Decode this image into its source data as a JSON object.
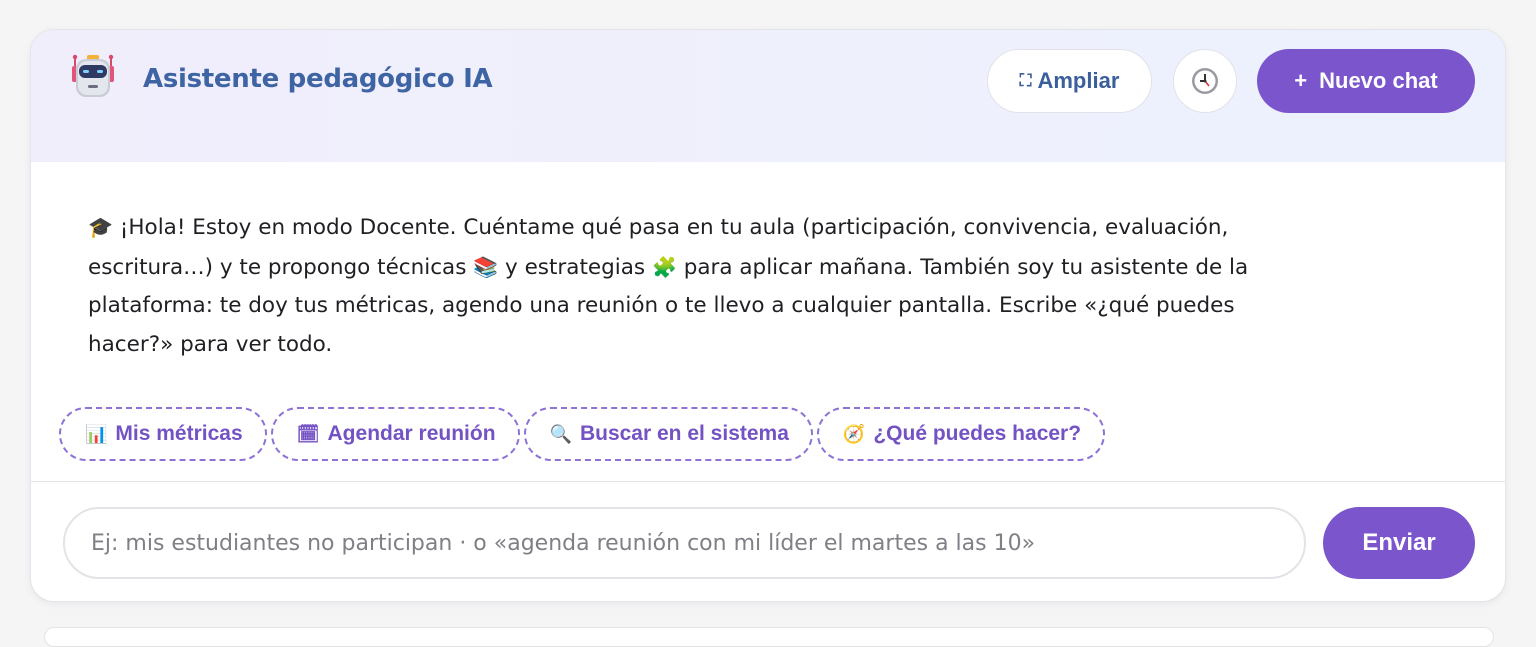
{
  "header": {
    "robot_icon": "robot-icon",
    "title": "Asistente pedagógico IA",
    "expand_icon": "expand-icon",
    "expand_label": "Ampliar",
    "history_icon": "clock-icon",
    "new_chat_plus": "+",
    "new_chat_label": "Nuevo chat"
  },
  "message": {
    "icon": "graduation-cap-icon",
    "part1": "¡Hola! Estoy en modo Docente. Cuéntame qué pasa en tu aula (participación, convivencia, evaluación, escritura…) y te propongo técnicas",
    "books_icon": "books-icon",
    "part2": "y estrategias",
    "puzzle_icon": "puzzle-icon",
    "part3": "para aplicar mañana. También soy tu asistente de la plataforma: te doy tus métricas, agendo una reunión o te llevo a cualquier pantalla. Escribe «¿qué puedes hacer?» para ver todo."
  },
  "quick_actions": [
    {
      "icon": "bar-chart-icon",
      "label": "Mis métricas"
    },
    {
      "icon": "calendar-icon",
      "label": "Agendar reunión"
    },
    {
      "icon": "magnifier-icon",
      "label": "Buscar en el sistema"
    },
    {
      "icon": "compass-icon",
      "label": "¿Qué puedes hacer?"
    }
  ],
  "composer": {
    "placeholder": "Ej: mis estudiantes no participan · o «agenda reunión con mi líder el martes a las 10»",
    "value": "",
    "send_label": "Enviar"
  },
  "colors": {
    "accent": "#7b55cc",
    "title": "#3f64a3",
    "chip_text": "#7352c4"
  }
}
